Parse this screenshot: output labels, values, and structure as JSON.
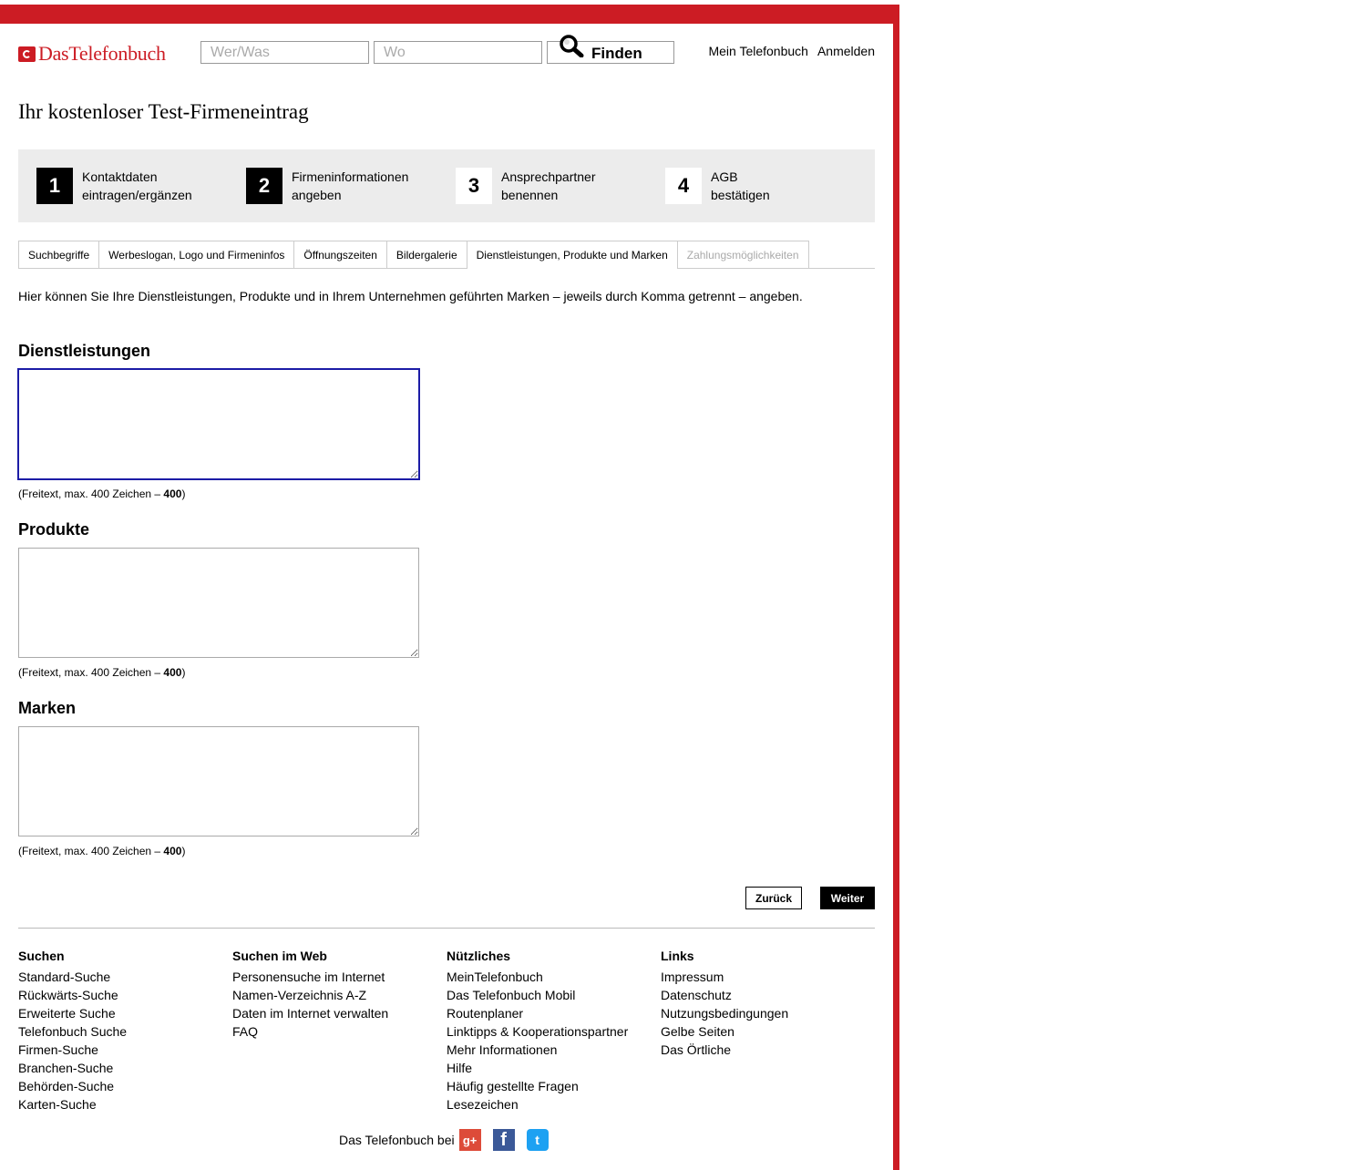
{
  "brand": {
    "name": "DasTelefonbuch",
    "color": "#cc1c24"
  },
  "search": {
    "what_placeholder": "Wer/Was",
    "where_placeholder": "Wo",
    "button": "Finden"
  },
  "toplinks": {
    "my": "Mein Telefonbuch",
    "login": "Anmelden"
  },
  "page_title": "Ihr kostenloser Test-Firmeneintrag",
  "steps": [
    {
      "num": "1",
      "line1": "Kontaktdaten",
      "line2": "eintragen/ergänzen",
      "done": true
    },
    {
      "num": "2",
      "line1": "Firmeninformationen",
      "line2": "angeben",
      "done": true
    },
    {
      "num": "3",
      "line1": "Ansprechpartner",
      "line2": "benennen",
      "done": false
    },
    {
      "num": "4",
      "line1": "AGB",
      "line2": "bestätigen",
      "done": false
    }
  ],
  "tabs": [
    {
      "label": "Suchbegriffe"
    },
    {
      "label": "Werbeslogan, Logo und Firmeninfos"
    },
    {
      "label": "Öffnungszeiten"
    },
    {
      "label": "Bildergalerie"
    },
    {
      "label": "Dienstleistungen, Produkte und Marken",
      "active": true
    },
    {
      "label": "Zahlungsmöglichkeiten",
      "disabled": true
    }
  ],
  "intro": "Hier können Sie Ihre Dienstleistungen, Produkte und in Ihrem Unternehmen geführten Marken – jeweils durch Komma getrennt – angeben.",
  "fields": [
    {
      "title": "Dienstleistungen",
      "value": "",
      "hint_prefix": "(Freitext, max. 400 Zeichen – ",
      "remaining": "400",
      "hint_suffix": ")"
    },
    {
      "title": "Produkte",
      "value": "",
      "hint_prefix": "(Freitext, max. 400 Zeichen – ",
      "remaining": "400",
      "hint_suffix": ")"
    },
    {
      "title": "Marken",
      "value": "",
      "hint_prefix": "(Freitext, max. 400 Zeichen – ",
      "remaining": "400",
      "hint_suffix": ")"
    }
  ],
  "buttons": {
    "back": "Zurück",
    "next": "Weiter"
  },
  "footer": {
    "columns": [
      {
        "title": "Suchen",
        "links": [
          "Standard-Suche",
          "Rückwärts-Suche",
          "Erweiterte Suche",
          "Telefonbuch Suche",
          "Firmen-Suche",
          "Branchen-Suche",
          "Behörden-Suche",
          "Karten-Suche"
        ]
      },
      {
        "title": "Suchen im Web",
        "links": [
          "Personensuche im Internet",
          "Namen-Verzeichnis A-Z",
          "Daten im Internet verwalten",
          "FAQ"
        ]
      },
      {
        "title": "Nützliches",
        "links": [
          "MeinTelefonbuch",
          "Das Telefonbuch Mobil",
          "Routenplaner",
          "Linktipps & Kooperationspartner",
          "Mehr Informationen",
          "Hilfe",
          "Häufig gestellte Fragen",
          "Lesezeichen"
        ]
      },
      {
        "title": "Links",
        "links": [
          "Impressum",
          "Datenschutz",
          "Nutzungsbedingungen",
          "Gelbe Seiten",
          "Das Örtliche"
        ]
      }
    ],
    "social_text": "Das Telefonbuch bei",
    "social_icons": [
      "google-plus-icon",
      "facebook-icon",
      "twitter-icon"
    ]
  }
}
